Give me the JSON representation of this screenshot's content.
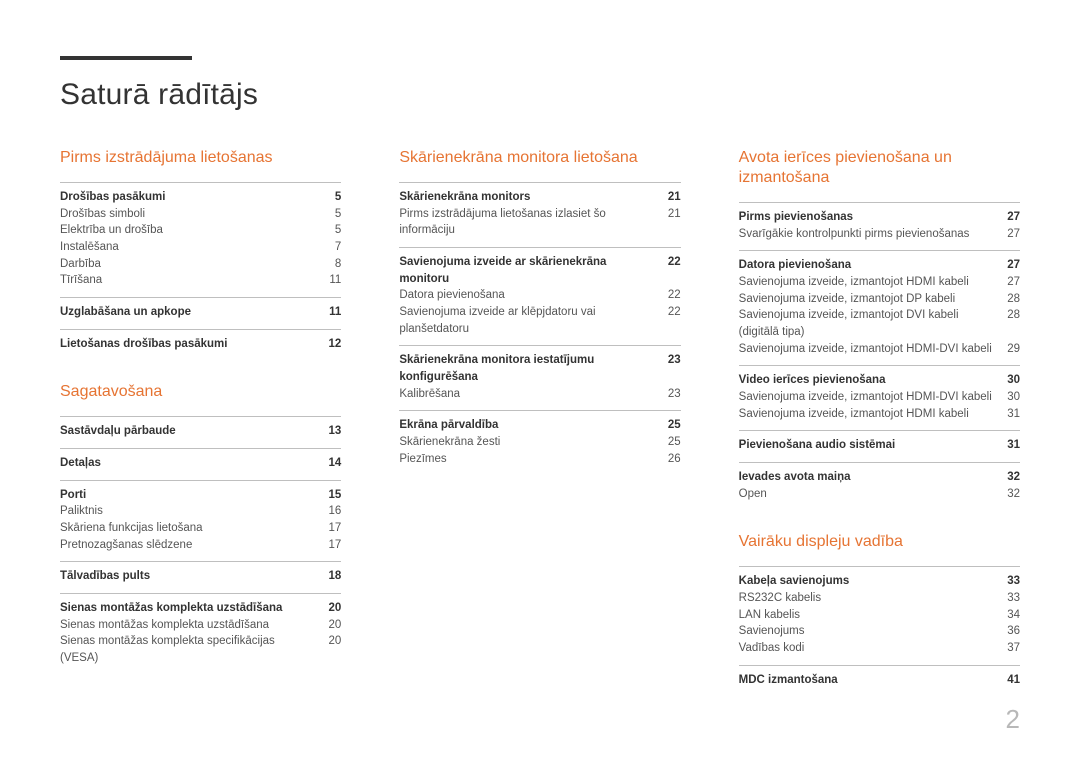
{
  "title": "Saturā rādītājs",
  "page_number": "2",
  "columns": [
    {
      "sections": [
        {
          "title": "Pirms izstrādājuma lietošanas",
          "groups": [
            {
              "head": {
                "label": "Drošības pasākumi",
                "page": "5"
              },
              "rows": [
                {
                  "label": "Drošības simboli",
                  "page": "5"
                },
                {
                  "label": "Elektrība un drošība",
                  "page": "5"
                },
                {
                  "label": "Instalēšana",
                  "page": "7"
                },
                {
                  "label": "Darbība",
                  "page": "8"
                },
                {
                  "label": "Tīrīšana",
                  "page": "11"
                }
              ]
            },
            {
              "head": {
                "label": "Uzglabāšana un apkope",
                "page": "11"
              },
              "rows": []
            },
            {
              "head": {
                "label": "Lietošanas drošības pasākumi",
                "page": "12"
              },
              "rows": []
            }
          ]
        },
        {
          "title": "Sagatavošana",
          "groups": [
            {
              "head": {
                "label": "Sastāvdaļu pārbaude",
                "page": "13"
              },
              "rows": []
            },
            {
              "head": {
                "label": "Detaļas",
                "page": "14"
              },
              "rows": []
            },
            {
              "head": {
                "label": "Porti",
                "page": "15"
              },
              "rows": [
                {
                  "label": "Paliktnis",
                  "page": "16"
                },
                {
                  "label": "Skāriena funkcijas lietošana",
                  "page": "17"
                },
                {
                  "label": "Pretnozagšanas slēdzene",
                  "page": "17"
                }
              ]
            },
            {
              "head": {
                "label": "Tālvadības pults",
                "page": "18"
              },
              "rows": []
            },
            {
              "head": {
                "label": "Sienas montāžas komplekta uzstādīšana",
                "page": "20"
              },
              "rows": [
                {
                  "label": "Sienas montāžas komplekta uzstādīšana",
                  "page": "20"
                },
                {
                  "label": "Sienas montāžas komplekta specifikācijas (VESA)",
                  "page": "20"
                }
              ]
            }
          ]
        }
      ]
    },
    {
      "sections": [
        {
          "title": "Skārienekrāna monitora lietošana",
          "groups": [
            {
              "head": {
                "label": "Skārienekrāna monitors",
                "page": "21"
              },
              "rows": [
                {
                  "label": "Pirms izstrādājuma lietošanas izlasiet šo informāciju",
                  "page": "21"
                }
              ]
            },
            {
              "head": {
                "label": "Savienojuma izveide ar skārienekrāna monitoru",
                "page": "22"
              },
              "rows": [
                {
                  "label": "Datora pievienošana",
                  "page": "22"
                },
                {
                  "label": "Savienojuma izveide ar klēpjdatoru vai planšetdatoru",
                  "page": "22"
                }
              ]
            },
            {
              "head": {
                "label": "Skārienekrāna monitora iestatījumu konfigurēšana",
                "page": "23"
              },
              "rows": [
                {
                  "label": "Kalibrēšana",
                  "page": "23"
                }
              ]
            },
            {
              "head": {
                "label": "Ekrāna pārvaldība",
                "page": "25"
              },
              "rows": [
                {
                  "label": "Skārienekrāna žesti",
                  "page": "25"
                },
                {
                  "label": "Piezīmes",
                  "page": "26"
                }
              ]
            }
          ]
        }
      ]
    },
    {
      "sections": [
        {
          "title": "Avota ierīces pievienošana un izmantošana",
          "groups": [
            {
              "head": {
                "label": "Pirms pievienošanas",
                "page": "27"
              },
              "rows": [
                {
                  "label": "Svarīgākie kontrolpunkti pirms pievienošanas",
                  "page": "27"
                }
              ]
            },
            {
              "head": {
                "label": "Datora pievienošana",
                "page": "27"
              },
              "rows": [
                {
                  "label": "Savienojuma izveide, izmantojot HDMI kabeli",
                  "page": "27"
                },
                {
                  "label": "Savienojuma izveide, izmantojot DP kabeli",
                  "page": "28"
                },
                {
                  "label": "Savienojuma izveide, izmantojot DVI kabeli (digitālā tipa)",
                  "page": "28"
                },
                {
                  "label": "Savienojuma izveide, izmantojot HDMI-DVI kabeli",
                  "page": "29"
                }
              ]
            },
            {
              "head": {
                "label": "Video ierīces pievienošana",
                "page": "30"
              },
              "rows": [
                {
                  "label": "Savienojuma izveide, izmantojot HDMI-DVI kabeli",
                  "page": "30"
                },
                {
                  "label": "Savienojuma izveide, izmantojot HDMI kabeli",
                  "page": "31"
                }
              ]
            },
            {
              "head": {
                "label": "Pievienošana audio sistēmai",
                "page": "31"
              },
              "rows": []
            },
            {
              "head": {
                "label": "Ievades avota maiņa",
                "page": "32"
              },
              "rows": [
                {
                  "label": "Open",
                  "page": "32"
                }
              ]
            }
          ]
        },
        {
          "title": "Vairāku displeju vadība",
          "groups": [
            {
              "head": {
                "label": "Kabeļa savienojums",
                "page": "33"
              },
              "rows": [
                {
                  "label": "RS232C kabelis",
                  "page": "33"
                },
                {
                  "label": "LAN kabelis",
                  "page": "34"
                },
                {
                  "label": "Savienojums",
                  "page": "36"
                },
                {
                  "label": "Vadības kodi",
                  "page": "37"
                }
              ]
            },
            {
              "head": {
                "label": "MDC izmantošana",
                "page": "41"
              },
              "rows": []
            }
          ]
        }
      ]
    }
  ]
}
